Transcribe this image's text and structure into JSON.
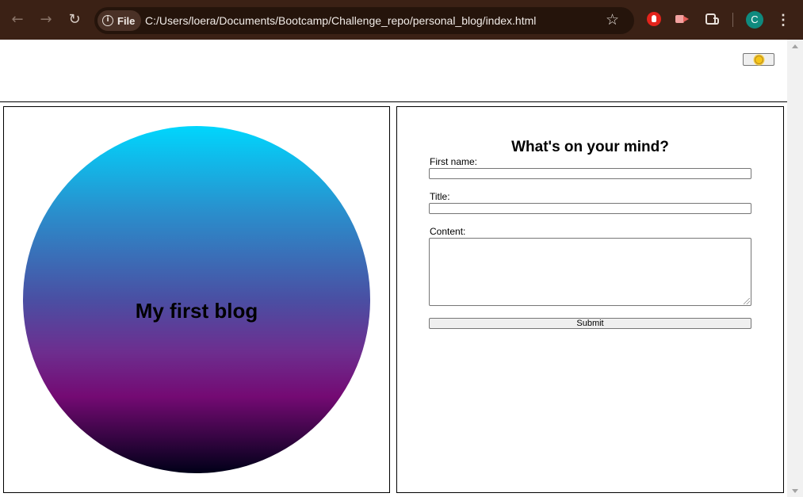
{
  "browser": {
    "back_icon": "arrow-left-icon",
    "forward_icon": "arrow-right-icon",
    "reload_icon": "reload-icon",
    "site_info_label": "File",
    "url": "C:/Users/loera/Documents/Bootcamp/Challenge_repo/personal_blog/index.html",
    "bookmark_icon": "star-icon",
    "extensions": [
      "red-hand-extension-icon",
      "camera-extension-icon",
      "puzzle-extensions-icon"
    ],
    "profile_initial": "C",
    "colors": {
      "toolbar": "#3b2115",
      "omnibox": "#25140b",
      "avatar": "#0f8a7e"
    }
  },
  "page": {
    "theme_toggle_icon": "sun-icon",
    "hero": {
      "title": "My first blog",
      "gradient": [
        "#00d6fd",
        "#4a4fa3",
        "#740a73",
        "#000018"
      ]
    },
    "form": {
      "heading": "What's on your mind?",
      "first_name_label": "First name:",
      "first_name_value": "",
      "title_label": "Title:",
      "title_value": "",
      "content_label": "Content:",
      "content_value": "",
      "submit_label": "Submit"
    }
  }
}
